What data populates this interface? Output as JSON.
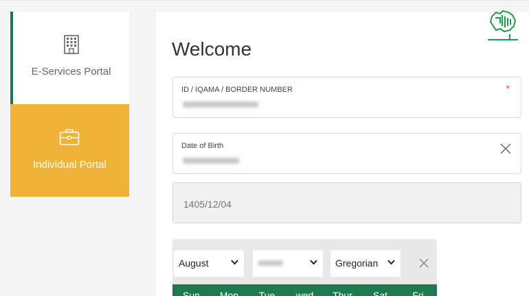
{
  "sidebar": {
    "eservices_label": "E-Services Portal",
    "individual_label": "Individual Portal"
  },
  "main": {
    "title": "Welcome",
    "id_field": {
      "label": "ID / IQAMA / BORDER NUMBER",
      "required_mark": "*"
    },
    "dob_field": {
      "label": "Date of Birth"
    },
    "hijri_value": "1405/12/04"
  },
  "datepicker": {
    "month": "August",
    "calendar_type": "Gregorian",
    "weekdays": [
      "Sun",
      "Mon",
      "Tue",
      "wed",
      "Thur",
      "Sat",
      "Fri"
    ]
  },
  "colors": {
    "green": "#1e7a4e",
    "orange": "#f0b33a",
    "required": "#e0463c"
  },
  "icons": [
    "building-icon",
    "briefcase-icon",
    "close-icon",
    "chevron-down-icon",
    "saudi-map-logo"
  ]
}
